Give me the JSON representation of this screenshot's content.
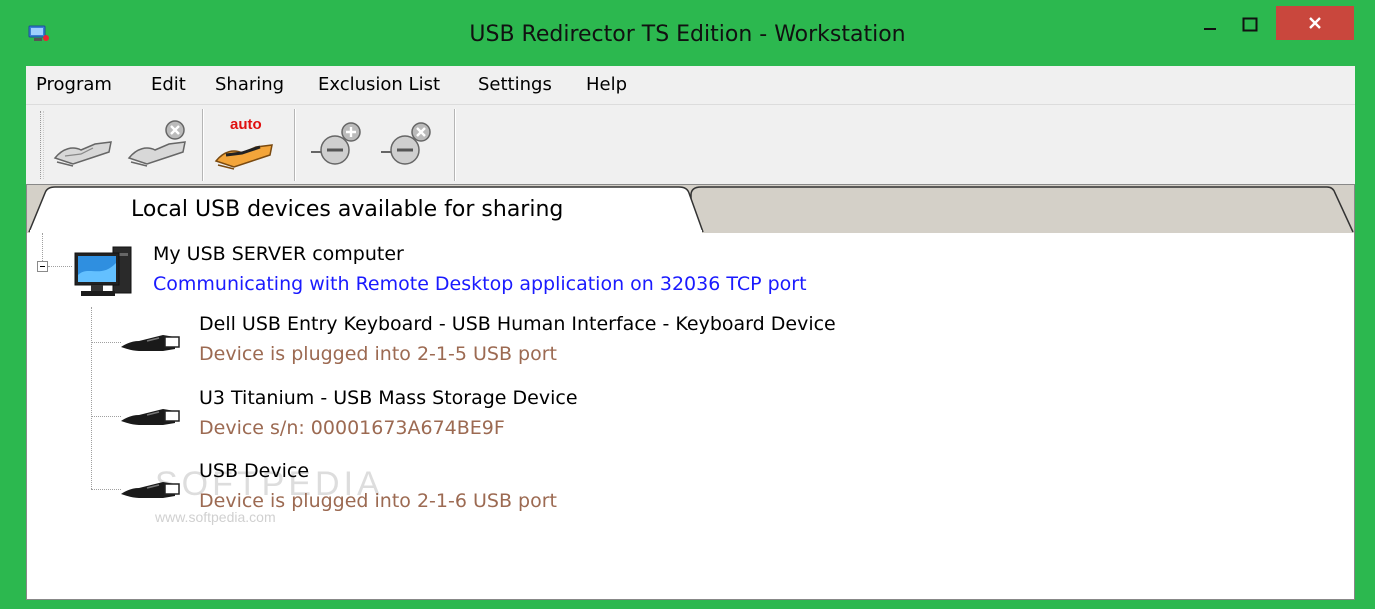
{
  "window": {
    "title": "USB Redirector TS Edition - Workstation",
    "frame_color": "#2cb84f",
    "close_color": "#c9473d"
  },
  "menu": [
    "Program",
    "Edit",
    "Sharing",
    "Exclusion List",
    "Settings",
    "Help"
  ],
  "toolbar": {
    "buttons": [
      {
        "name": "share-device-icon"
      },
      {
        "name": "unshare-device-icon"
      },
      {
        "name": "auto-share-icon",
        "label": "auto"
      },
      {
        "name": "add-exclusion-icon"
      },
      {
        "name": "remove-exclusion-icon"
      }
    ]
  },
  "tabs": [
    "Local USB devices available for sharing",
    ""
  ],
  "tree": {
    "server": {
      "title": "My USB SERVER computer",
      "status": "Communicating with Remote Desktop application on 32036 TCP port",
      "status_color": "#1a1aff"
    },
    "devices": [
      {
        "title": "Dell USB Entry Keyboard - USB Human Interface - Keyboard Device",
        "detail": "Device is plugged into 2-1-5 USB port"
      },
      {
        "title": "U3 Titanium - USB Mass Storage Device",
        "detail": "Device s/n: 00001673A674BE9F"
      },
      {
        "title": "USB Device",
        "detail": "Device is plugged into 2-1-6 USB port"
      }
    ],
    "detail_color": "#9c6a52"
  },
  "watermark": {
    "text": "SOFTPEDIA",
    "url": "www.softpedia.com"
  }
}
